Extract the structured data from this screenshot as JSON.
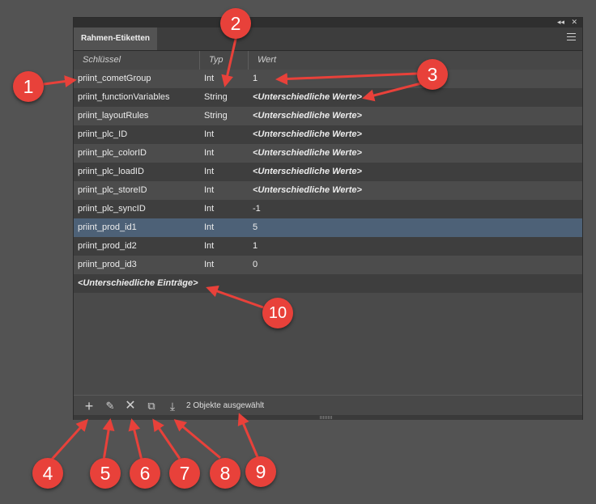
{
  "panel": {
    "tab_title": "Rahmen-Etiketten",
    "window_controls": {
      "collapse": "◂◂",
      "close": "✕"
    }
  },
  "columns": {
    "key": "Schlüssel",
    "type": "Typ",
    "value": "Wert"
  },
  "rows": [
    {
      "key": "priint_cometGroup",
      "type": "Int",
      "value": "1"
    },
    {
      "key": "priint_functionVariables",
      "type": "String",
      "value": "<Unterschiedliche Werte>"
    },
    {
      "key": "priint_layoutRules",
      "type": "String",
      "value": "<Unterschiedliche Werte>"
    },
    {
      "key": "priint_plc_ID",
      "type": "Int",
      "value": "<Unterschiedliche Werte>"
    },
    {
      "key": "priint_plc_colorID",
      "type": "Int",
      "value": "<Unterschiedliche Werte>"
    },
    {
      "key": "priint_plc_loadID",
      "type": "Int",
      "value": "<Unterschiedliche Werte>"
    },
    {
      "key": "priint_plc_storeID",
      "type": "Int",
      "value": "<Unterschiedliche Werte>"
    },
    {
      "key": "priint_plc_syncID",
      "type": "Int",
      "value": "-1"
    },
    {
      "key": "priint_prod_id1",
      "type": "Int",
      "value": "5"
    },
    {
      "key": "priint_prod_id2",
      "type": "Int",
      "value": "1"
    },
    {
      "key": "priint_prod_id3",
      "type": "Int",
      "value": "0"
    }
  ],
  "selected_row_index": 8,
  "summary_row": "<Unterschiedliche Einträge>",
  "toolbar": {
    "add_icon": "+",
    "edit_icon": "✎",
    "delete_icon": "✕",
    "duplicate_icon": "⧉",
    "import_icon": "⤓",
    "status": "2 Objekte ausgewählt"
  },
  "annotations": [
    "1",
    "2",
    "3",
    "4",
    "5",
    "6",
    "7",
    "8",
    "9",
    "10"
  ],
  "colors": {
    "annotation": "#e8413a",
    "selection": "#4d6177"
  }
}
